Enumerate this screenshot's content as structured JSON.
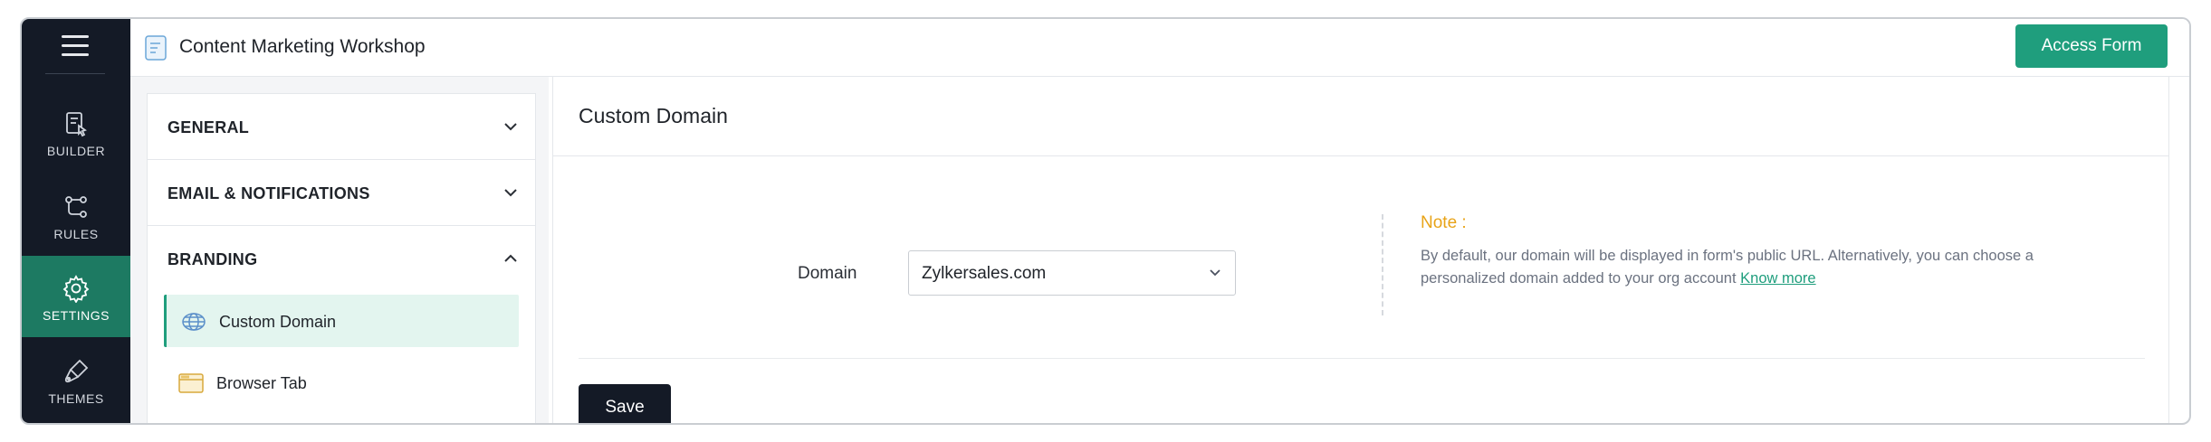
{
  "app": {
    "form_title": "Content Marketing Workshop",
    "access_button": "Access Form"
  },
  "nav": {
    "items": [
      {
        "label": "BUILDER",
        "icon": "builder-icon"
      },
      {
        "label": "RULES",
        "icon": "rules-icon"
      },
      {
        "label": "SETTINGS",
        "icon": "gear-icon",
        "active": true
      },
      {
        "label": "THEMES",
        "icon": "themes-icon"
      }
    ]
  },
  "settings_panel": {
    "sections": [
      {
        "label": "GENERAL",
        "expanded": false
      },
      {
        "label": "EMAIL & NOTIFICATIONS",
        "expanded": false
      },
      {
        "label": "BRANDING",
        "expanded": true
      }
    ],
    "branding_items": [
      {
        "label": "Custom Domain",
        "icon": "globe-icon",
        "active": true
      },
      {
        "label": "Browser Tab",
        "icon": "browser-tab-icon"
      }
    ]
  },
  "main": {
    "title": "Custom Domain",
    "domain_label": "Domain",
    "domain_value": "Zylkersales.com",
    "note_title": "Note :",
    "note_text": "By default, our domain will be displayed in form's public URL. Alternatively, you can choose a personalized domain added to your org account",
    "note_link": "Know more",
    "save_button": "Save"
  },
  "colors": {
    "nav_bg": "#141a26",
    "accent": "#1f9e7d",
    "note_title": "#e8a317",
    "active_item_bg": "#e3f5ef"
  }
}
